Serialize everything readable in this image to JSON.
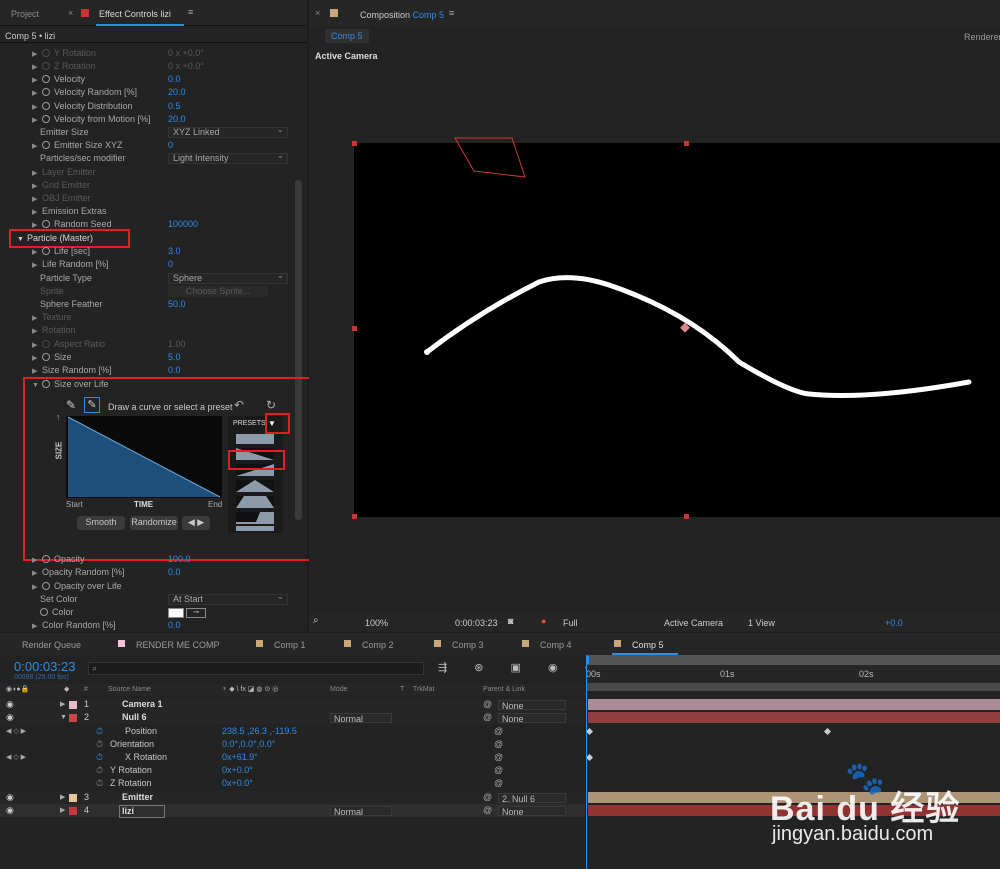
{
  "panels": {
    "project_tab": "Project",
    "effect_controls_tab": "Effect Controls lizi",
    "comp_path": "Comp 5 • lizi"
  },
  "effect_rows": [
    {
      "label": "Y Rotation",
      "value": "0 x +0.0°",
      "dim": true,
      "stopwatch": true
    },
    {
      "label": "Z Rotation",
      "value": "0 x +0.0°",
      "dim": true,
      "stopwatch": true
    },
    {
      "label": "Velocity",
      "value": "0.0",
      "dim": false,
      "stopwatch": true
    },
    {
      "label": "Velocity Random [%]",
      "value": "20.0",
      "dim": false,
      "stopwatch": true
    },
    {
      "label": "Velocity Distribution",
      "value": "0.5",
      "dim": false,
      "stopwatch": true
    },
    {
      "label": "Velocity from Motion [%]",
      "value": "20.0",
      "dim": false,
      "stopwatch": true
    }
  ],
  "emitter": {
    "size_label": "Emitter Size",
    "size_value": "XYZ Linked",
    "size_xyz_label": "Emitter Size XYZ",
    "size_xyz_value": "0",
    "modifier_label": "Particles/sec modifier",
    "modifier_value": "Light Intensity",
    "layer_emitter": "Layer Emitter",
    "grid_emitter": "Grid Emitter",
    "obj_emitter": "OBJ Emitter",
    "emission_extras": "Emission Extras",
    "random_seed_label": "Random Seed",
    "random_seed_value": "100000"
  },
  "particle": {
    "section": "Particle (Master)",
    "life_label": "Life [sec]",
    "life_value": "3.0",
    "life_random_label": "Life Random [%]",
    "life_random_value": "0",
    "type_label": "Particle Type",
    "type_value": "Sphere",
    "sprite_label": "Sprite",
    "sprite_button": "Choose Sprite...",
    "feather_label": "Sphere Feather",
    "feather_value": "50.0",
    "texture": "Texture",
    "rotation": "Rotation",
    "aspect_label": "Aspect Ratio",
    "aspect_value": "1.00",
    "size_label": "Size",
    "size_value": "5.0",
    "size_random_label": "Size Random [%]",
    "size_random_value": "0.0",
    "sol_label": "Size over Life"
  },
  "curve_editor": {
    "hint": "Draw a curve or select a preset",
    "presets": "PRESETS",
    "y_label": "SIZE",
    "x_start": "Start",
    "x_mid": "TIME",
    "x_end": "End",
    "smooth": "Smooth",
    "randomize": "Randomize"
  },
  "after_curve": {
    "opacity_label": "Opacity",
    "opacity_value": "100.0",
    "opacity_random_label": "Opacity Random [%]",
    "opacity_random_value": "0.0",
    "opacity_life": "Opacity over Life",
    "set_color_label": "Set Color",
    "set_color_value": "At Start",
    "color_label": "Color",
    "color_random_label": "Color Random [%]",
    "color_random_value": "0.0"
  },
  "composition": {
    "tab_title": "Composition",
    "tab_comp": "Comp 5",
    "sub_tab": "Comp 5",
    "renderer": "Renderer:",
    "view_label": "Active Camera"
  },
  "viewer_toolbar": {
    "zoom": "100%",
    "timecode": "0:00:03:23",
    "quality": "Full",
    "camera": "Active Camera",
    "views": "1 View",
    "exposure": "+0.0"
  },
  "bottom_tabs": [
    "Render Queue",
    "RENDER ME COMP",
    "Comp 1",
    "Comp 2",
    "Comp 3",
    "Comp 4",
    "Comp 5"
  ],
  "bottom_tab_colors": [
    "",
    "#f4c2d6",
    "#c8a878",
    "#c8a878",
    "#c8a878",
    "#c8a878",
    "#c8a878"
  ],
  "timeline": {
    "timecode": "0:00:03:23",
    "frames": "00098 (25.00 fps)",
    "search_placeholder": "",
    "headers": {
      "source": "Source Name",
      "mode": "Mode",
      "t": "T",
      "trkmat": "TrkMat",
      "parent": "Parent & Link"
    },
    "ruler": [
      "00s",
      "01s",
      "02s"
    ],
    "layers": [
      {
        "num": "1",
        "name": "Camera 1",
        "color": "#e7b8c8",
        "mode": "",
        "parent": "None"
      },
      {
        "num": "2",
        "name": "Null 6",
        "color": "#c04a4a",
        "mode": "Normal",
        "parent": "None"
      },
      {
        "num": "3",
        "name": "Emitter",
        "color": "#e8c49a",
        "mode": "",
        "parent": "2. Null 6"
      },
      {
        "num": "4",
        "name": "lizi",
        "color": "#c03a3a",
        "mode": "Normal",
        "parent": "None"
      }
    ],
    "props": [
      {
        "name": "Position",
        "value": "238.5 ,26.3 ,-119.5"
      },
      {
        "name": "Orientation",
        "value": "0.0°,0.0°,0.0°"
      },
      {
        "name": "X Rotation",
        "value": "0x+61.9°"
      },
      {
        "name": "Y Rotation",
        "value": "0x+0.0°"
      },
      {
        "name": "Z Rotation",
        "value": "0x+0.0°"
      }
    ]
  },
  "watermark": {
    "brand": "Bai du 经验",
    "url": "jingyan.baidu.com"
  }
}
